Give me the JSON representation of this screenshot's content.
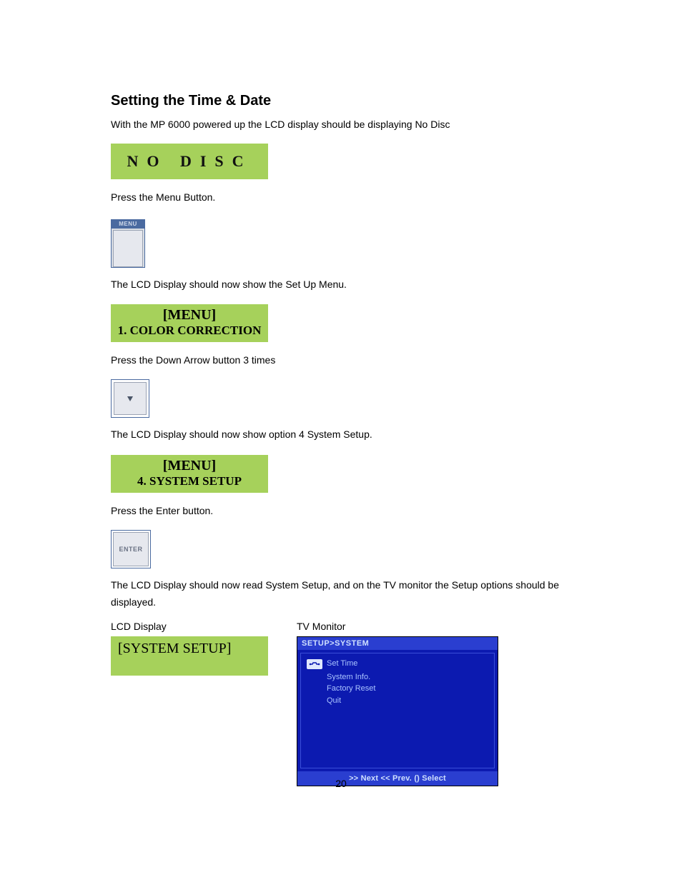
{
  "title": "Setting the Time & Date",
  "paragraphs": {
    "intro": "With the MP 6000 powered up the LCD display should be displaying No Disc",
    "pressMenu": "Press the Menu Button.",
    "afterMenu": "The LCD Display should now show the Set Up Menu.",
    "pressDown": "Press the Down Arrow button 3 times",
    "afterDown": "The LCD Display should now show option 4 System Setup.",
    "pressEnter": "Press the Enter button.",
    "afterEnter": "The LCD Display should now read System Setup, and on the TV monitor the Setup options should be displayed."
  },
  "lcd": {
    "nodisc": "NO DISC",
    "menu1_top": "[MENU]",
    "menu1_bottom": "1. COLOR CORRECTION",
    "menu2_top": "[MENU]",
    "menu2_bottom": "4. SYSTEM SETUP",
    "system": "[SYSTEM SETUP]"
  },
  "buttons": {
    "menuCap": "MENU",
    "enterLabel": "ENTER"
  },
  "captions": {
    "lcd": "LCD Display",
    "tv": "TV Monitor"
  },
  "tv": {
    "header": "SETUP>SYSTEM",
    "items": [
      "Set Time",
      "System Info.",
      "Factory Reset",
      "Quit"
    ],
    "footer": ">> Next  << Prev.  () Select"
  },
  "pageNumber": "20"
}
